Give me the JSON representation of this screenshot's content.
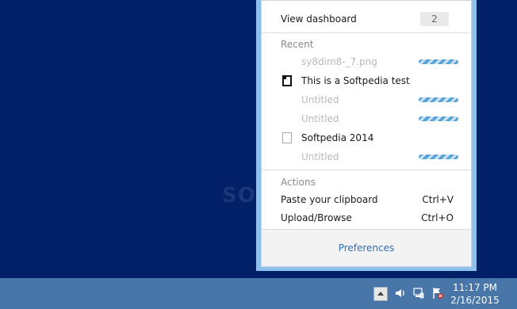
{
  "watermark": "SOFTPEDIA",
  "popup": {
    "dashboard": {
      "label": "View dashboard",
      "count": "2"
    },
    "recent": {
      "heading": "Recent",
      "items": [
        {
          "label": "sy8dim8-_7.png",
          "state": "uploading"
        },
        {
          "label": "This is a Softpedia test",
          "state": "done",
          "icon": "document-filled-icon"
        },
        {
          "label": "Untitled",
          "state": "uploading"
        },
        {
          "label": "Untitled",
          "state": "uploading"
        },
        {
          "label": "Softpedia 2014",
          "state": "done",
          "icon": "document-icon"
        },
        {
          "label": "Untitled",
          "state": "uploading"
        }
      ]
    },
    "actions": {
      "heading": "Actions",
      "items": [
        {
          "label": "Paste your clipboard",
          "shortcut": "Ctrl+V"
        },
        {
          "label": "Upload/Browse",
          "shortcut": "Ctrl+O"
        }
      ]
    },
    "footer": {
      "preferences_label": "Preferences"
    }
  },
  "taskbar": {
    "time": "11:17 PM",
    "date": "2/16/2015",
    "tray_icons": [
      "show-hidden-icons-icon",
      "volume-icon",
      "network-icon",
      "action-center-icon"
    ]
  },
  "colors": {
    "desktop": "#022068",
    "taskbar": "#4876a8",
    "popup_border": "#8cc1ec",
    "link": "#2f6fb3",
    "progress": "#5aa4da"
  }
}
